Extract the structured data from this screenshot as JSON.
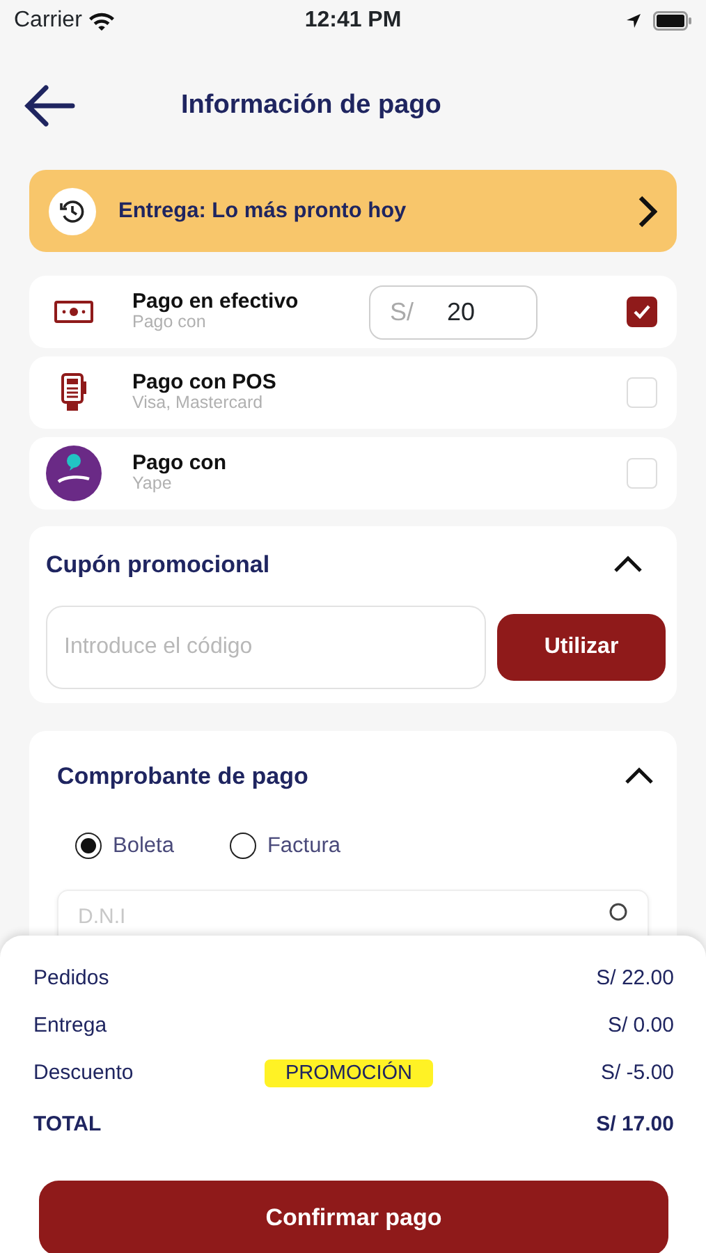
{
  "status_bar": {
    "carrier": "Carrier",
    "time": "12:41 PM"
  },
  "header": {
    "title": "Información de pago"
  },
  "delivery": {
    "text": "Entrega: Lo más pronto hoy"
  },
  "payment_methods": [
    {
      "kind": "cash",
      "name": "Pago en efectivo",
      "subtitle": "Pago con",
      "selected": true,
      "amount_prefix": "S/",
      "amount": "20"
    },
    {
      "kind": "pos",
      "name": "Pago con POS",
      "subtitle": "Visa, Mastercard",
      "selected": false
    },
    {
      "kind": "yape",
      "name": "Pago con",
      "subtitle": "Yape",
      "selected": false
    }
  ],
  "coupon": {
    "title": "Cupón promocional",
    "expanded": true,
    "placeholder": "Introduce el código",
    "button": "Utilizar"
  },
  "receipt": {
    "title": "Comprobante de pago",
    "expanded": true,
    "options": [
      {
        "label": "Boleta",
        "selected": true
      },
      {
        "label": "Factura",
        "selected": false
      }
    ],
    "field_placeholder": "D.N.I"
  },
  "summary": {
    "rows": [
      {
        "label": "Pedidos",
        "value": "S/ 22.00"
      },
      {
        "label": "Entrega",
        "value": "S/ 0.00"
      },
      {
        "label": "Descuento",
        "tag": "PROMOCIÓN",
        "value": "S/ -5.00"
      }
    ],
    "total": {
      "label": "TOTAL",
      "value": "S/ 17.00"
    },
    "button": "Confirmar pago"
  }
}
